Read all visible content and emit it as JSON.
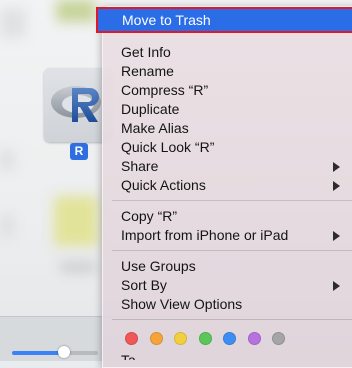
{
  "finder": {
    "selected_file_badge": "R",
    "zoom_level": 0.6
  },
  "context_menu": {
    "highlighted_item": "Move to Trash",
    "groups": [
      [
        "Get Info",
        "Rename",
        "Compress “R”",
        "Duplicate",
        "Make Alias",
        "Quick Look “R”",
        "Share",
        "Quick Actions"
      ],
      [
        "Copy “R”",
        "Import from iPhone or iPad"
      ],
      [
        "Use Groups",
        "Sort By",
        "Show View Options"
      ]
    ],
    "submenu_items": [
      "Share",
      "Quick Actions",
      "Import from iPhone or iPad",
      "Sort By"
    ],
    "tags": [
      {
        "name": "red",
        "color": "#f25757"
      },
      {
        "name": "orange",
        "color": "#f5a33a"
      },
      {
        "name": "yellow",
        "color": "#f2cf3f"
      },
      {
        "name": "green",
        "color": "#5cc65a"
      },
      {
        "name": "blue",
        "color": "#3d8ef2"
      },
      {
        "name": "purple",
        "color": "#b672e0"
      },
      {
        "name": "gray",
        "color": "#a5a5a5"
      }
    ],
    "cut_off_item": "Ta"
  },
  "colors": {
    "highlight": "#2a6de6",
    "highlight_outline": "#e0182a"
  }
}
